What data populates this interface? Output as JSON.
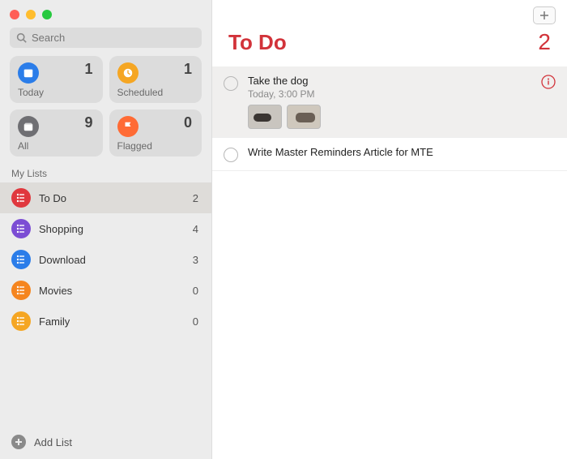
{
  "sidebar": {
    "search_placeholder": "Search",
    "smart": [
      {
        "label": "Today",
        "count": 1,
        "color": "#2b7de9"
      },
      {
        "label": "Scheduled",
        "count": 1,
        "color": "#f5a623"
      },
      {
        "label": "All",
        "count": 9,
        "color": "#6f6f73"
      },
      {
        "label": "Flagged",
        "count": 0,
        "color": "#ff6b35"
      }
    ],
    "section_title": "My Lists",
    "lists": [
      {
        "name": "To Do",
        "count": 2,
        "color": "#e0383e",
        "selected": true
      },
      {
        "name": "Shopping",
        "count": 4,
        "color": "#7c4dd4",
        "selected": false
      },
      {
        "name": "Download",
        "count": 3,
        "color": "#2b7de9",
        "selected": false
      },
      {
        "name": "Movies",
        "count": 0,
        "color": "#f5851f",
        "selected": false
      },
      {
        "name": "Family",
        "count": 0,
        "color": "#f5a623",
        "selected": false
      }
    ],
    "add_list_label": "Add List"
  },
  "main": {
    "title": "To Do",
    "title_color": "#d2333a",
    "count": 2,
    "items": [
      {
        "name": "Take the dog",
        "meta": "Today, 3:00 PM",
        "selected": true,
        "has_info": true,
        "thumbs": 2
      },
      {
        "name": "Write Master Reminders Article for MTE",
        "meta": "",
        "selected": false,
        "has_info": false,
        "thumbs": 0
      }
    ]
  }
}
